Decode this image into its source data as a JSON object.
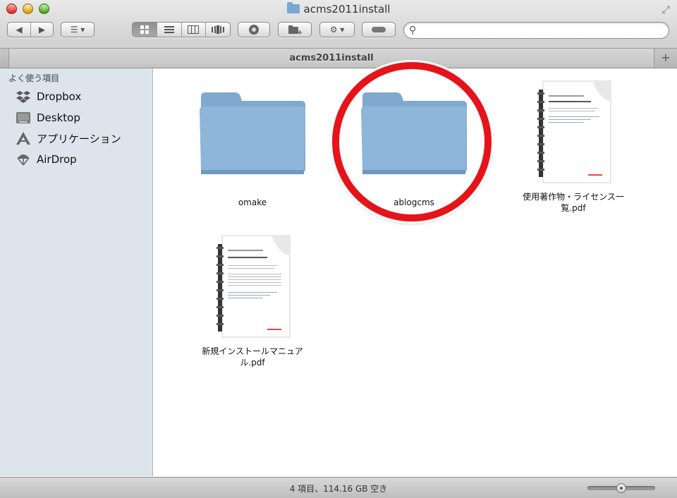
{
  "window": {
    "title": "acms2011install"
  },
  "tab": {
    "label": "acms2011install"
  },
  "sidebar": {
    "heading": "よく使う項目",
    "items": [
      {
        "label": "Dropbox",
        "icon": "dropbox-icon"
      },
      {
        "label": "Desktop",
        "icon": "desktop-icon"
      },
      {
        "label": "アプリケーション",
        "icon": "applications-icon"
      },
      {
        "label": "AirDrop",
        "icon": "airdrop-icon"
      }
    ]
  },
  "files": [
    {
      "name": "omake",
      "kind": "folder"
    },
    {
      "name": "ablogcms",
      "kind": "folder"
    },
    {
      "name_line1": "使用著作物・ライセンス一",
      "name_line2": "覧.pdf",
      "kind": "pdf"
    },
    {
      "name_line1": "新規インストールマニュア",
      "name_line2": "ル.pdf",
      "kind": "pdf"
    }
  ],
  "status": {
    "text": "4 項目、114.16 GB 空き"
  },
  "colors": {
    "folder": "#8db6d9",
    "highlight_circle": "#e5141a",
    "sidebar_bg": "#dde4ec"
  }
}
